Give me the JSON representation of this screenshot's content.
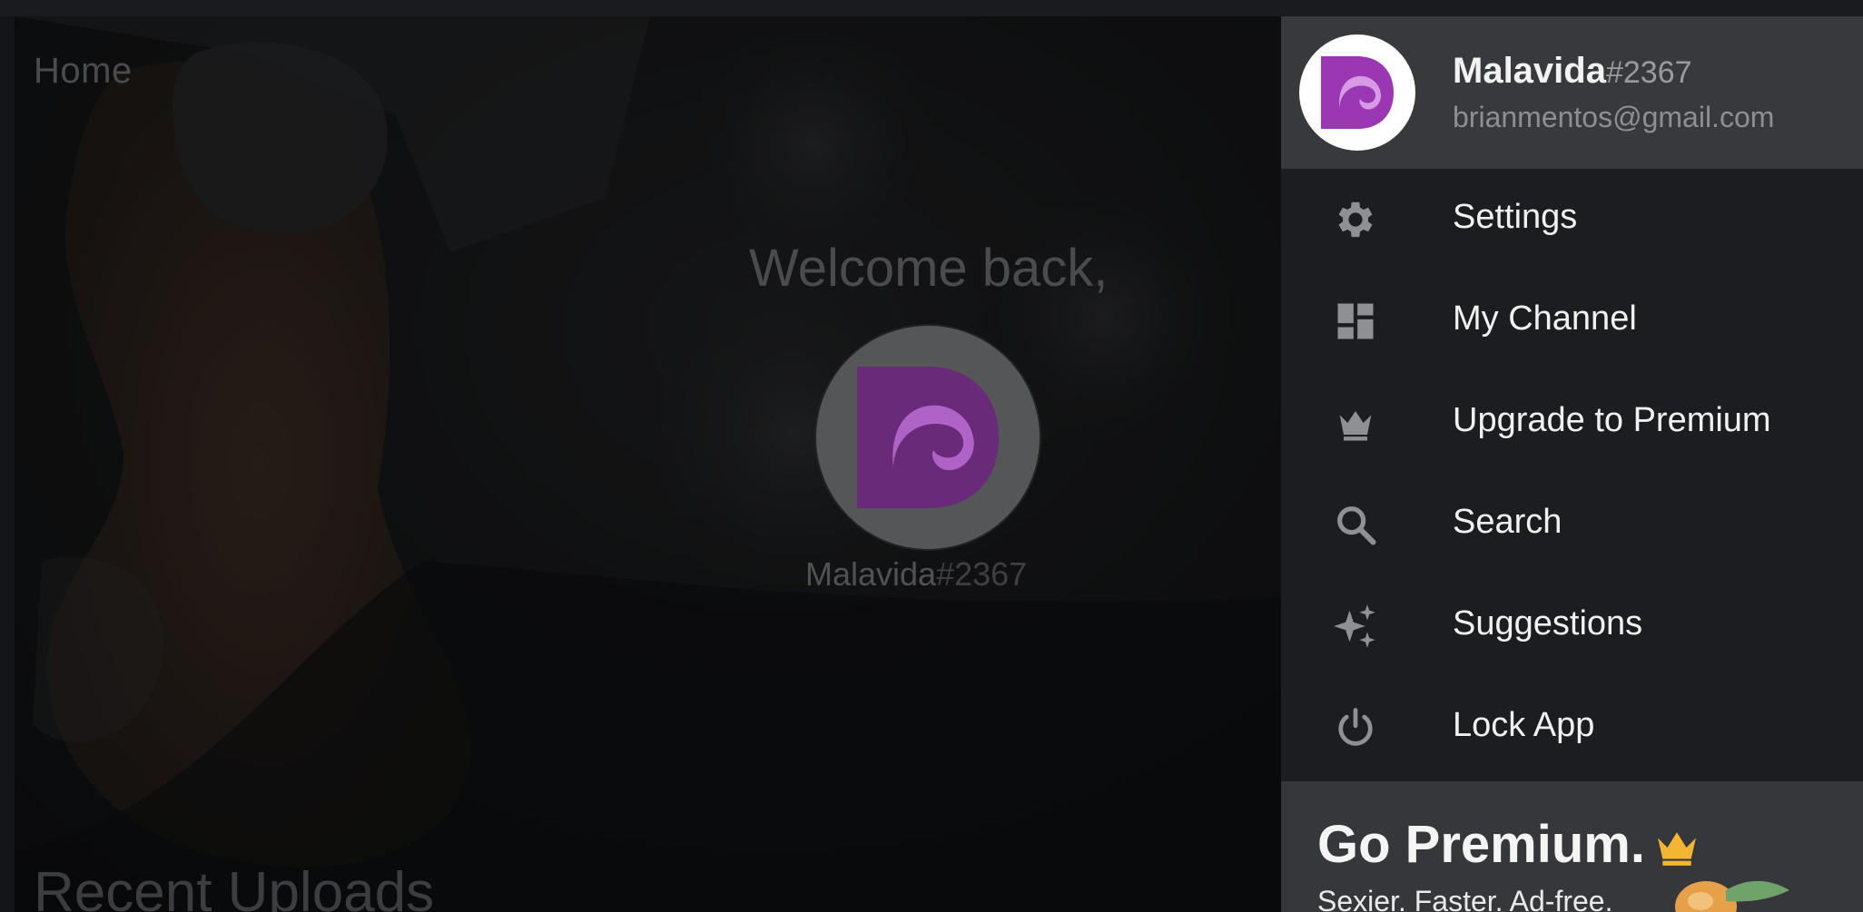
{
  "home": {
    "title": "Home",
    "welcome": "Welcome back,",
    "username": "Malavida",
    "user_tag": "#2367",
    "recent_heading": "Recent Uploads"
  },
  "drawer": {
    "profile": {
      "name": "Malavida",
      "tag": "#2367",
      "email": "brianmentos@gmail.com"
    },
    "items": [
      {
        "label": "Settings",
        "icon": "gear-icon"
      },
      {
        "label": "My Channel",
        "icon": "dashboard-icon"
      },
      {
        "label": "Upgrade to Premium",
        "icon": "crown-icon"
      },
      {
        "label": "Search",
        "icon": "search-icon"
      },
      {
        "label": "Suggestions",
        "icon": "sparkle-icon"
      },
      {
        "label": "Lock App",
        "icon": "power-icon"
      }
    ],
    "premium": {
      "title": "Go Premium.",
      "subtitle": "Sexier. Faster. Ad-free."
    }
  },
  "colors": {
    "brand_purple": "#8a2f9e",
    "premium_gold": "#f2b632",
    "drawer_bg": "#1c1d20",
    "profile_bg": "#38393c"
  }
}
